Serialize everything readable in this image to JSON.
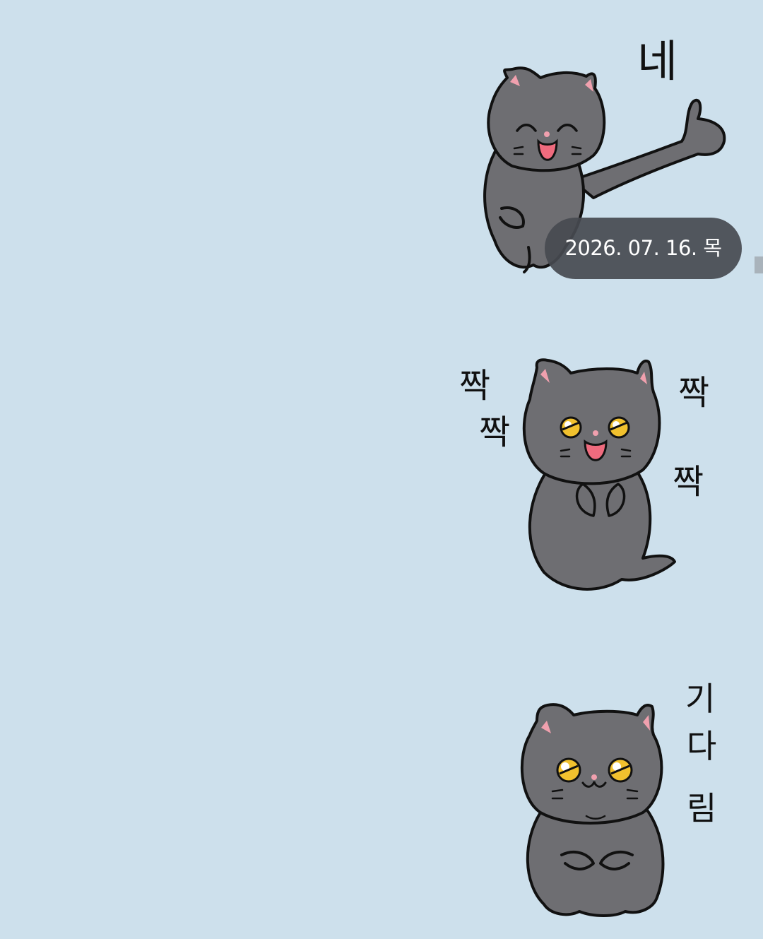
{
  "chat": {
    "date_divider": "2026. 07. 16. 목",
    "messages": [
      {
        "type": "sticker",
        "character": "gray-cat",
        "pose": "thumbs-up",
        "caption": "네"
      },
      {
        "type": "sticker",
        "character": "gray-cat",
        "pose": "clapping",
        "caption_words": [
          "짝",
          "짝",
          "짝",
          "짝"
        ]
      },
      {
        "type": "sticker",
        "character": "gray-cat",
        "pose": "waiting",
        "caption_chars": [
          "기",
          "다",
          "림"
        ]
      }
    ]
  },
  "colors": {
    "background": "#cde0ec",
    "cat_body": "#6e6e72",
    "cat_outline": "#111111",
    "cat_mouth": "#ef6b7e",
    "cat_ear_inner": "#f0a0ae",
    "cat_eye": "#f1c12e",
    "date_pill": "#464a50"
  }
}
